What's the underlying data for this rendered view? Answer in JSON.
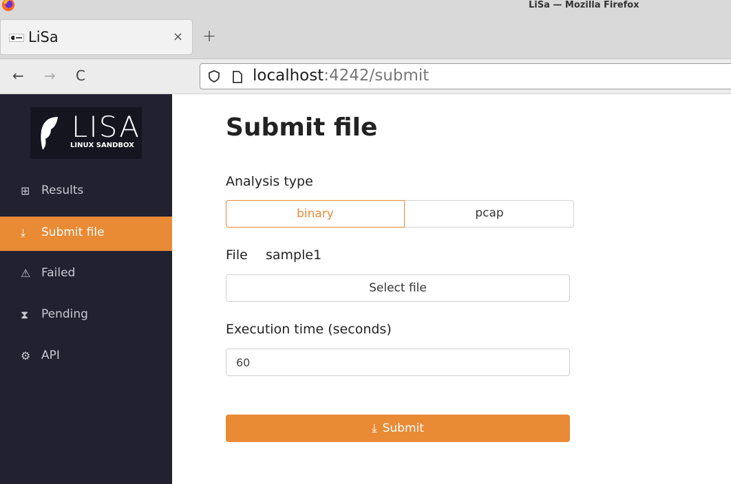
{
  "browser": {
    "window_title": "LiSa — Mozilla Firefox",
    "tab_title": "LiSa",
    "tab_close": "×",
    "new_tab": "+",
    "url_host": "localhost",
    "url_rest": ":4242/submit",
    "nav": {
      "back": "←",
      "forward": "→",
      "reload": "C"
    }
  },
  "logo": {
    "text": "LISA",
    "subtitle": "LINUX SANDBOX"
  },
  "sidebar": {
    "items": [
      {
        "label": "Results",
        "icon": "⊞",
        "icon_name": "grid-icon"
      },
      {
        "label": "Submit file",
        "icon": "⤓",
        "icon_name": "upload-icon",
        "active": true
      },
      {
        "label": "Failed",
        "icon": "⚠",
        "icon_name": "warning-icon"
      },
      {
        "label": "Pending",
        "icon": "⧗",
        "icon_name": "hourglass-icon"
      },
      {
        "label": "API",
        "icon": "⚙",
        "icon_name": "api-icon"
      }
    ]
  },
  "form": {
    "title": "Submit file",
    "analysis_label": "Analysis type",
    "analysis_options": [
      "binary",
      "pcap"
    ],
    "analysis_selected": "binary",
    "file_label": "File",
    "file_name": "sample1",
    "select_file_label": "Select file",
    "time_label": "Execution time (seconds)",
    "time_value": "60",
    "submit_label": "Submit"
  },
  "colors": {
    "accent": "#e98a35",
    "sidebar_bg": "#212130"
  }
}
